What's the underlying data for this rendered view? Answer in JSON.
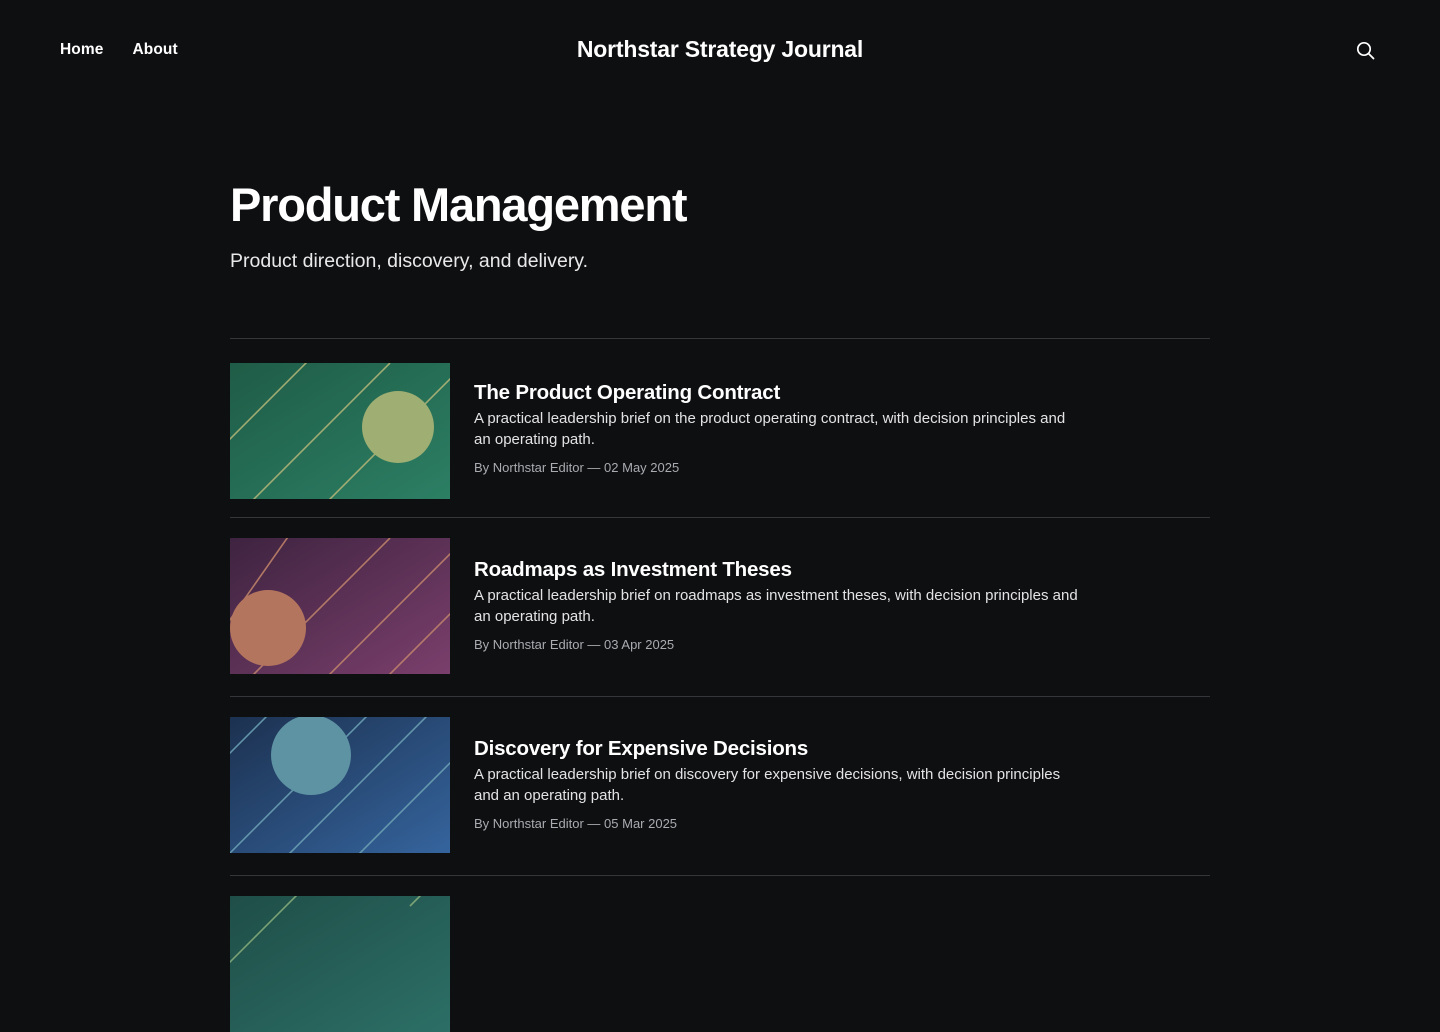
{
  "header": {
    "nav": [
      {
        "label": "Home"
      },
      {
        "label": "About"
      }
    ],
    "site_title": "Northstar Strategy Journal",
    "search_icon": "search-icon"
  },
  "page": {
    "title": "Product Management",
    "description": "Product direction, discovery, and delivery."
  },
  "posts": [
    {
      "title": "The Product Operating Contract",
      "excerpt": "A practical leadership brief on the product operating contract, with decision principles and an operating path.",
      "meta": "By Northstar Editor — 02 May 2025",
      "thumb": {
        "from": "#1f5c47",
        "to": "#2c7f64",
        "circle": "#9fae72",
        "lines": "#b7b77a"
      }
    },
    {
      "title": "Roadmaps as Investment Theses",
      "excerpt": "A practical leadership brief on roadmaps as investment theses, with decision principles and an operating path.",
      "meta": "By Northstar Editor — 03 Apr 2025",
      "thumb": {
        "from": "#3e2340",
        "to": "#7a3f6c",
        "circle": "#b4755e",
        "lines": "#c3876a"
      }
    },
    {
      "title": "Discovery for Expensive Decisions",
      "excerpt": "A practical leadership brief on discovery for expensive decisions, with decision principles and an operating path.",
      "meta": "By Northstar Editor — 05 Mar 2025",
      "thumb": {
        "from": "#1c3150",
        "to": "#35649d",
        "circle": "#5d93a3",
        "lines": "#6ea4b6"
      }
    },
    {
      "title": "",
      "excerpt": "",
      "meta": "",
      "thumb": {
        "from": "#1f4e48",
        "to": "#2c6f66",
        "circle": "#8aa272",
        "lines": "#8ab07c"
      }
    }
  ]
}
